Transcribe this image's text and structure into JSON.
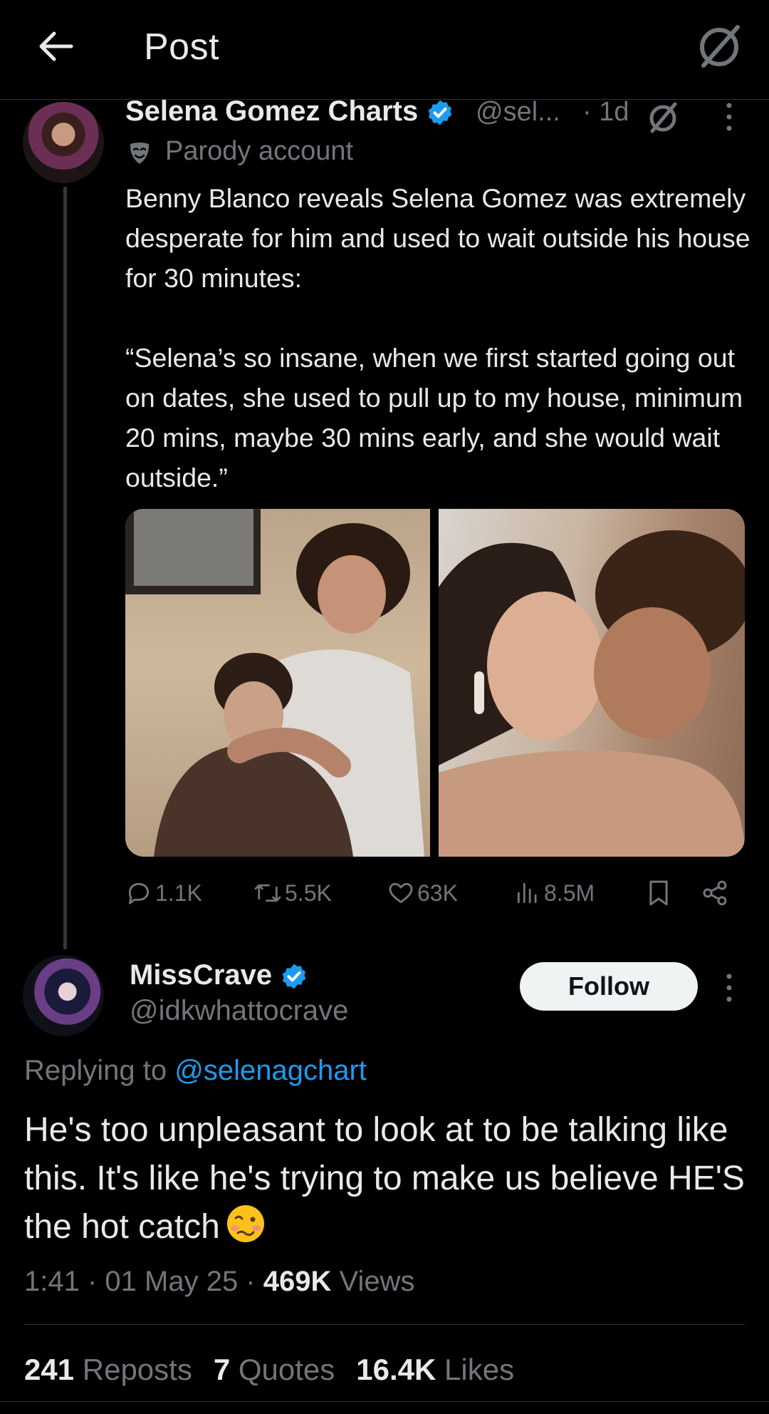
{
  "header": {
    "title": "Post"
  },
  "tweet": {
    "author_name": "Selena Gomez Charts",
    "handle": "@sel...",
    "time": "· 1d",
    "parody_label": "Parody account",
    "body": "Benny Blanco reveals Selena Gomez was extremely desperate for him and used to wait outside his house for 30 minutes:\n\n“Selena’s so insane, when we first started going out on dates, she used to pull up to my house, minimum 20 mins, maybe 30 mins early, and she would wait outside.”",
    "actions": {
      "replies": "1.1K",
      "reposts": "5.5K",
      "likes": "63K",
      "views": "8.5M"
    }
  },
  "reply": {
    "author_name": "MissCrave",
    "handle": "@idkwhattocrave",
    "follow_label": "Follow",
    "replying_prefix": "Replying to",
    "replying_to": "@selenagchart",
    "body": "He's too unpleasant to look at to be talking like this. It's like he's trying to make us believe HE'S the hot catch",
    "time": "1:41",
    "date": "01 May 25",
    "views_count": "469K",
    "views_label": "Views",
    "reposts_count": "241",
    "reposts_label": "Reposts",
    "quotes_count": "7",
    "quotes_label": "Quotes",
    "likes_count": "16.4K",
    "likes_label": "Likes"
  },
  "colors": {
    "background": "#000000",
    "text": "#e7e9ea",
    "muted": "#71767b",
    "link": "#1d9bf0",
    "verified": "#1d9bf0"
  },
  "icons": [
    "back-arrow-icon",
    "grok-icon",
    "verified-icon",
    "parody-mask-icon",
    "more-icon",
    "reply-icon",
    "repost-icon",
    "like-icon",
    "views-icon",
    "bookmark-icon",
    "share-icon",
    "woozy-face-emoji"
  ]
}
